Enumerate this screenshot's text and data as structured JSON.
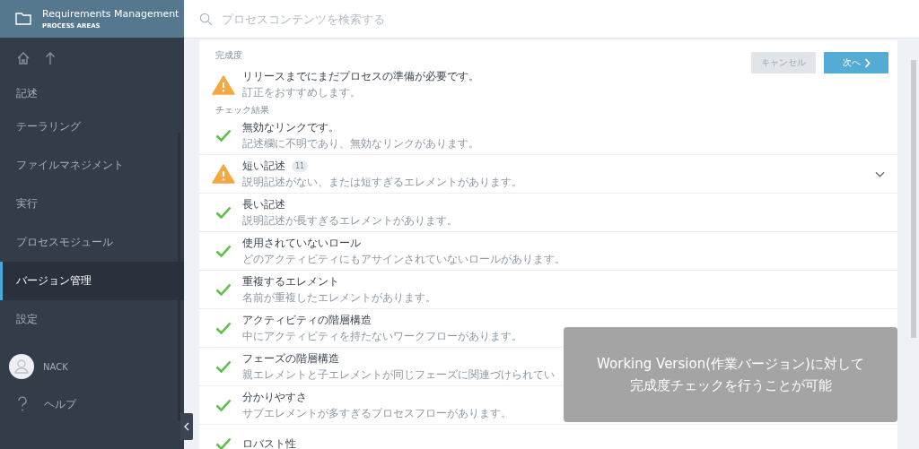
{
  "sidebar": {
    "header": {
      "title": "Requirements Management",
      "subtitle": "PROCESS AREAS"
    },
    "items": [
      {
        "label": "記述",
        "selected": false
      },
      {
        "label": "テーラリング",
        "selected": false
      },
      {
        "label": "ファイルマネジメント",
        "selected": false
      },
      {
        "label": "実行",
        "selected": false
      },
      {
        "label": "プロセスモジュール",
        "selected": false
      },
      {
        "label": "バージョン管理",
        "selected": true
      },
      {
        "label": "設定",
        "selected": false
      }
    ],
    "user": {
      "name": "NACK"
    },
    "help": {
      "label": "ヘルプ"
    }
  },
  "search": {
    "placeholder": "プロセスコンテンツを検索する"
  },
  "panel": {
    "completeness_label": "完成度",
    "summary": {
      "kind": "warning",
      "title": "リリースまでにまだプロセスの準備が必要です。",
      "description": "訂正をおすすめします。"
    },
    "buttons": {
      "cancel": "キャンセル",
      "next": "次へ"
    },
    "results_label": "チェック結果",
    "checks": [
      {
        "kind": "ok",
        "title": "無効なリンクです。",
        "description": "記述欄に不明であり、無効なリンクがあります。"
      },
      {
        "kind": "warning",
        "title": "短い記述",
        "count": "11",
        "description": "説明記述がない、または短すぎるエレメントがあります。"
      },
      {
        "kind": "ok",
        "title": "長い記述",
        "description": "説明記述が長すぎるエレメントがあります。"
      },
      {
        "kind": "ok",
        "title": "使用されていないロール",
        "description": "どのアクティビティにもアサインされていないロールがあります。"
      },
      {
        "kind": "ok",
        "title": "重複するエレメント",
        "description": "名前が重複したエレメントがあります。"
      },
      {
        "kind": "ok",
        "title": "アクティビティの階層構造",
        "description": "中にアクティビティを持たないワークフローがあります。"
      },
      {
        "kind": "ok",
        "title": "フェーズの階層構造",
        "description": "親エレメントと子エレメントが同じフェーズに関連づけられてい"
      },
      {
        "kind": "ok",
        "title": "分かりやすさ",
        "description": "サブエレメントが多すぎるプロセスフローがあります。"
      },
      {
        "kind": "ok",
        "title": "ロバスト性"
      }
    ]
  },
  "caption": {
    "lines": [
      "Working Version(作業バージョン)に対して",
      "完成度チェックを行うことが可能"
    ]
  }
}
